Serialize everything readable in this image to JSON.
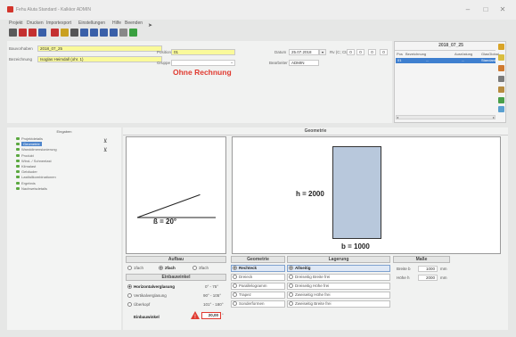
{
  "window": {
    "title": "Fehu Aluta Standard - Kalkkor ADMIN",
    "minimize": "–",
    "maximize": "□",
    "close": "✕"
  },
  "menu": [
    "Projekt",
    "Drucken",
    "Importexport",
    "Einstellungen",
    "Hilfe",
    "Beenden"
  ],
  "toolbar": {
    "icons": [
      {
        "name": "new-icon",
        "color": "#5a5a5a"
      },
      {
        "name": "save-icon",
        "color": "#c43030"
      },
      {
        "name": "save-all-icon",
        "color": "#c43030"
      },
      {
        "name": "print-icon",
        "color": "#3a60a8"
      },
      {
        "name": "delete-icon",
        "color": "#c43030"
      },
      {
        "name": "copy-icon",
        "color": "#c9a020"
      },
      {
        "name": "sum-icon",
        "color": "#555555"
      },
      {
        "name": "grid-icon",
        "color": "#3a60a8"
      },
      {
        "name": "list-icon",
        "color": "#3a60a8"
      },
      {
        "name": "table-icon",
        "color": "#3a60a8"
      },
      {
        "name": "report-icon",
        "color": "#3a60a8"
      },
      {
        "name": "settings-icon",
        "color": "#888888"
      },
      {
        "name": "export-icon",
        "color": "#3aa040"
      }
    ]
  },
  "form": {
    "bauvorhaben_label": "Bauvorhaben",
    "bauvorhaben_value": "2018_07_25",
    "bezeichnung_label": "Bezeichnung",
    "bezeichnung_value": "Isoglas Heimdall (ohr. 1)",
    "position_label": "Position",
    "position_value": "01",
    "gruppe_label": "Gruppe",
    "gruppe_value": "",
    "datum_label": "Datum",
    "datum_value": "25.07.2018",
    "bearbeiter_label": "Bearbeiter",
    "bearbeiter_value": "ADMIN",
    "rv_label": "Rv (C; Ctr)",
    "rv_values": [
      "0",
      "0",
      "0",
      "0"
    ],
    "ohne_rechnung": "Ohne Rechnung"
  },
  "right_panel": {
    "title": "2018_07_25",
    "headers": [
      "Pos",
      "Bezeichnung",
      "Ausrüstung",
      "GlasGlobal"
    ],
    "row": [
      "01",
      "...",
      "...",
      "Standard"
    ]
  },
  "tree": {
    "title": "Eingaben",
    "items": [
      {
        "label": "Projektdetails",
        "selected": false
      },
      {
        "label": "Geometrie",
        "selected": true
      },
      {
        "label": "Wanddimensionierung",
        "selected": false
      },
      {
        "label": "Produkt",
        "selected": false
      },
      {
        "label": "Wind- / Schneelast",
        "selected": false
      },
      {
        "label": "Klimalast",
        "selected": false
      },
      {
        "label": "Gebäuder",
        "selected": false
      },
      {
        "label": "Lastfallkombinationen",
        "selected": false
      },
      {
        "label": "Ergebnis",
        "selected": false
      },
      {
        "label": "Nachweisdetails",
        "selected": false
      }
    ]
  },
  "geometry": {
    "title": "Geometrie",
    "angle_label": "ß = 20°",
    "angle_degrees": 20,
    "height_label": "h = 2000",
    "width_label": "b = 1000",
    "aufbau": {
      "title": "Aufbau",
      "options": [
        {
          "label": "1fach",
          "selected": false
        },
        {
          "label": "2fach",
          "selected": true
        },
        {
          "label": "3fach",
          "selected": false
        }
      ]
    },
    "einbauwinkel": {
      "title": "Einbauwinkel",
      "options": [
        {
          "label": "Horizontalverglasung",
          "range": "0° - 75°",
          "selected": true
        },
        {
          "label": "Vertikalverglasung",
          "range": "90° - 105°",
          "selected": false
        },
        {
          "label": "Überkopf",
          "range": "101° - 180°",
          "selected": false
        }
      ],
      "value_label": "Einbauwinkel",
      "value": "20,00",
      "unit": "°"
    },
    "geometrie": {
      "title": "Geometrie",
      "options": [
        {
          "label": "Rechteck",
          "selected": true
        },
        {
          "label": "Dreieck",
          "selected": false
        },
        {
          "label": "Parallelogramm",
          "selected": false
        },
        {
          "label": "Trapez",
          "selected": false
        },
        {
          "label": "Sonderformen",
          "selected": false
        }
      ]
    },
    "lagerung": {
      "title": "Lagerung",
      "options": [
        {
          "label": "Allseitig",
          "selected": true
        },
        {
          "label": "Dreiseitig Breite frei",
          "selected": false
        },
        {
          "label": "Dreiseitig Höhe frei",
          "selected": false
        },
        {
          "label": "Zweiseitig Höhe frei",
          "selected": false
        },
        {
          "label": "Zweiseitig Breite frei",
          "selected": false
        }
      ]
    },
    "masse": {
      "title": "Maße",
      "breite_label": "Breite b",
      "breite_value": "1000",
      "hoehe_label": "Höhe h",
      "hoehe_value": "2000",
      "unit": "mm"
    }
  }
}
